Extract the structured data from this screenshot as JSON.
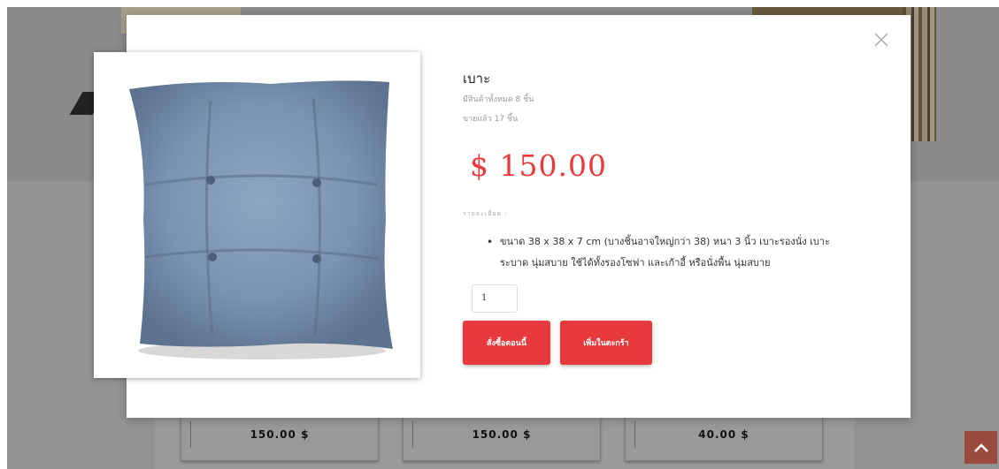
{
  "background": {
    "card_prices": [
      "150.00 $",
      "150.00 $",
      "40.00 $"
    ]
  },
  "modal": {
    "product_title": "เบาะ",
    "stock_text": "มีสินค้าทั้งหมด 8 ชิ้น",
    "sold_text": "ขายแล้ว 17 ชิ้น",
    "price": "$ 150.00",
    "details_label": "รายละเอียด :",
    "description": "ขนาด 38 x 38 x 7 cm (บางชิ้นอาจใหญ่กว่า 38) หนา 3 นิ้ว เบาะรองนั่ง เบาะระบาด นุ่มสบาย ใช้ได้ทั้งรองโซฟา และเก้าอี้ หรือนั่งพื้น นุ่มสบาย",
    "quantity": "1",
    "buy_now_label": "สั่งซื้อตอนนี้",
    "add_to_cart_label": "เพิ่มในตะกร้า"
  },
  "icons": {
    "close": "close-icon",
    "scroll_top": "chevron-up-icon"
  },
  "colors": {
    "accent": "#e8393c",
    "overlay_bg": "#8f8f8f",
    "scroll_top_bg": "#9b4a40"
  }
}
